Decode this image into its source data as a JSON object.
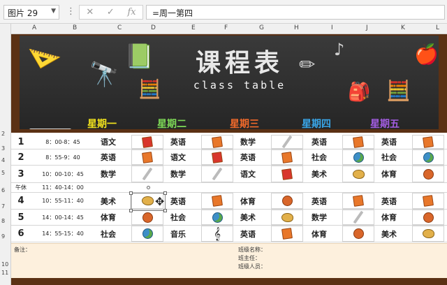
{
  "formula_bar": {
    "name_box": "图片 29",
    "formula": "=周一第四"
  },
  "column_headers": [
    "A",
    "B",
    "C",
    "D",
    "E",
    "F",
    "G",
    "H",
    "I",
    "J",
    "K",
    "L"
  ],
  "row_headers": [
    "2",
    "3",
    "4",
    "5",
    "6",
    "7",
    "8",
    "9",
    "10",
    "11"
  ],
  "banner": {
    "title": "课程表",
    "subtitle": "class table",
    "days": [
      {
        "label": "星期一",
        "color": "#f2e31d"
      },
      {
        "label": "星期二",
        "color": "#7ed957"
      },
      {
        "label": "星期三",
        "color": "#f26a2a"
      },
      {
        "label": "星期四",
        "color": "#39a6e8"
      },
      {
        "label": "星期五",
        "color": "#a45de3"
      }
    ]
  },
  "schedule": [
    {
      "num": "1",
      "time": "8：00-8：45",
      "cells": [
        {
          "subject": "语文",
          "icon": "book-red-icon"
        },
        {
          "subject": "英语",
          "icon": "book-icon"
        },
        {
          "subject": "数学",
          "icon": "pencil-icon"
        },
        {
          "subject": "英语",
          "icon": "book-icon"
        },
        {
          "subject": "英语",
          "icon": "book-icon"
        }
      ]
    },
    {
      "num": "2",
      "time": "8：55-9：40",
      "cells": [
        {
          "subject": "英语",
          "icon": "book-icon"
        },
        {
          "subject": "语文",
          "icon": "book-red-icon"
        },
        {
          "subject": "英语",
          "icon": "book-icon"
        },
        {
          "subject": "社会",
          "icon": "globe-icon"
        },
        {
          "subject": "社会",
          "icon": "globe-icon"
        }
      ]
    },
    {
      "num": "3",
      "time": "10：00-10：45",
      "cells": [
        {
          "subject": "数学",
          "icon": "pencil-icon"
        },
        {
          "subject": "数学",
          "icon": "pencil-icon"
        },
        {
          "subject": "语文",
          "icon": "book-red-icon"
        },
        {
          "subject": "美术",
          "icon": "palette-icon"
        },
        {
          "subject": "体育",
          "icon": "ball-icon"
        }
      ]
    },
    {
      "num": "午休",
      "time": "11：40-14：00",
      "cells": []
    },
    {
      "num": "4",
      "time": "10：55-11：40",
      "cells": [
        {
          "subject": "美术",
          "icon": "palette-icon"
        },
        {
          "subject": "英语",
          "icon": "book-icon"
        },
        {
          "subject": "体育",
          "icon": "ball-icon"
        },
        {
          "subject": "英语",
          "icon": "book-icon"
        },
        {
          "subject": "英语",
          "icon": "book-icon"
        }
      ]
    },
    {
      "num": "5",
      "time": "14：00-14：45",
      "cells": [
        {
          "subject": "体育",
          "icon": "ball-icon"
        },
        {
          "subject": "社会",
          "icon": "globe-icon"
        },
        {
          "subject": "美术",
          "icon": "palette-icon"
        },
        {
          "subject": "数学",
          "icon": "pencil-icon"
        },
        {
          "subject": "体育",
          "icon": "ball-icon"
        }
      ]
    },
    {
      "num": "6",
      "time": "14：55-15：40",
      "cells": [
        {
          "subject": "社会",
          "icon": "globe-icon"
        },
        {
          "subject": "音乐",
          "icon": "treble-clef-icon"
        },
        {
          "subject": "英语",
          "icon": "book-icon"
        },
        {
          "subject": "体育",
          "icon": "ball-icon"
        },
        {
          "subject": "美术",
          "icon": "palette-icon"
        }
      ]
    }
  ],
  "notes": {
    "remark": "备注：",
    "class_name": "班级名称：",
    "head_teacher": "班主任：",
    "members": "班级人员："
  }
}
